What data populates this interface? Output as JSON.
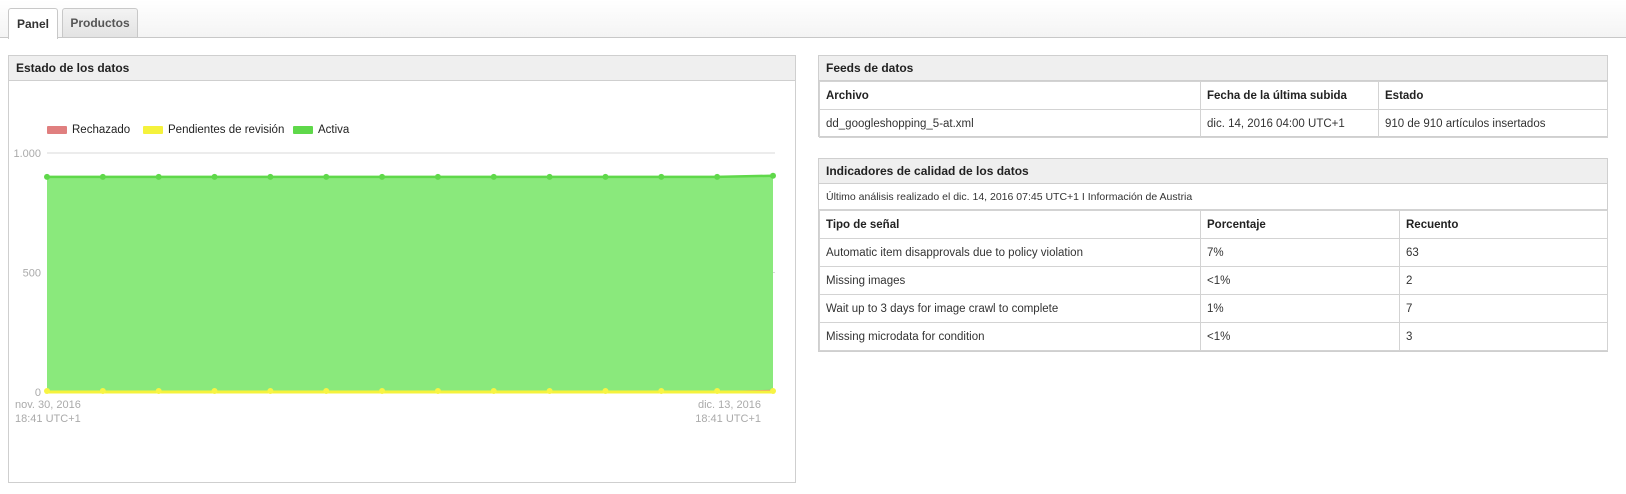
{
  "tabs": [
    {
      "label": "Panel",
      "active": true
    },
    {
      "label": "Productos",
      "active": false
    }
  ],
  "chart_panel": {
    "title": "Estado de los datos"
  },
  "chart_data": {
    "type": "area",
    "title": "",
    "legend_position": "top-left",
    "legend": [
      {
        "name": "Rechazado",
        "color": "#e07f7f"
      },
      {
        "name": "Pendientes de revisión",
        "color": "#f5f23c"
      },
      {
        "name": "Activa",
        "color": "#5fd84a"
      }
    ],
    "ylim": [
      0,
      1000
    ],
    "y_ticks": [
      "0",
      "500",
      "1.000"
    ],
    "x_tick_labels": [
      {
        "line1": "nov. 30, 2016",
        "line2": "18:41 UTC+1"
      },
      {
        "line1": "dic. 13, 2016",
        "line2": "18:41 UTC+1"
      }
    ],
    "point_count": 14,
    "series": [
      {
        "name": "Rechazado",
        "color": "#e07f7f",
        "values": [
          0,
          0,
          0,
          0,
          0,
          0,
          0,
          0,
          0,
          0,
          0,
          0,
          0,
          5
        ]
      },
      {
        "name": "Pendientes de revisión",
        "color": "#f5f23c",
        "values": [
          0,
          0,
          0,
          0,
          0,
          0,
          0,
          0,
          0,
          0,
          0,
          0,
          0,
          0
        ]
      },
      {
        "name": "Activa",
        "color": "#5fd84a",
        "fill": "#8ae97c",
        "values": [
          900,
          900,
          900,
          900,
          900,
          900,
          900,
          900,
          900,
          900,
          900,
          900,
          900,
          905
        ]
      }
    ],
    "grid": true
  },
  "feeds": {
    "title": "Feeds de datos",
    "headers": [
      "Archivo",
      "Fecha de la última subida",
      "Estado"
    ],
    "rows": [
      [
        "dd_googleshopping_5-at.xml",
        "dic. 14, 2016 04:00 UTC+1",
        "910 de 910 artículos insertados"
      ]
    ]
  },
  "quality": {
    "title": "Indicadores de calidad de los datos",
    "info": "Último análisis realizado el dic. 14, 2016 07:45 UTC+1 I Información de Austria",
    "headers": [
      "Tipo de señal",
      "Porcentaje",
      "Recuento"
    ],
    "rows": [
      [
        "Automatic item disapprovals due to policy violation",
        "7%",
        "63"
      ],
      [
        "Missing images",
        "<1%",
        "2"
      ],
      [
        "Wait up to 3 days for image crawl to complete",
        "1%",
        "7"
      ],
      [
        "Missing microdata for condition",
        "<1%",
        "3"
      ]
    ]
  }
}
